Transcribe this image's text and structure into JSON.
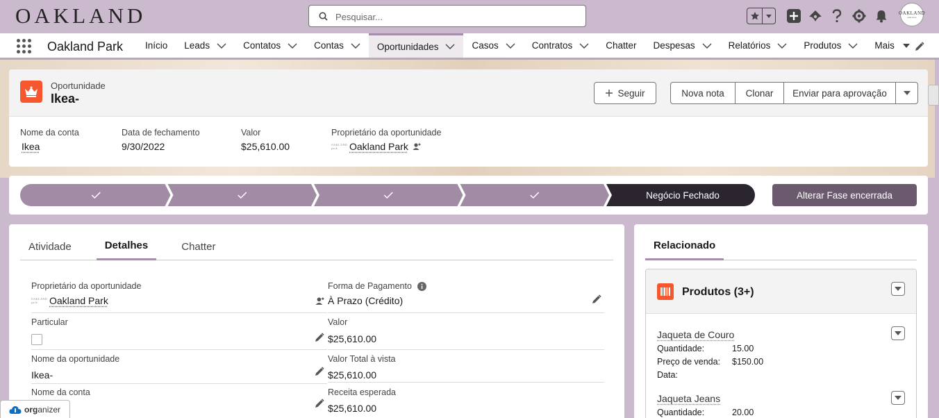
{
  "header": {
    "logo": "OAKLAND",
    "search_placeholder": "Pesquisar...",
    "avatar_text": "OAKLAND",
    "avatar_sub": "park store"
  },
  "nav": {
    "app_name": "Oakland Park",
    "items": [
      {
        "label": "Início",
        "chevron": false
      },
      {
        "label": "Leads",
        "chevron": true
      },
      {
        "label": "Contatos",
        "chevron": true
      },
      {
        "label": "Contas",
        "chevron": true
      },
      {
        "label": "Oportunidades",
        "chevron": true,
        "active": true
      },
      {
        "label": "Casos",
        "chevron": true
      },
      {
        "label": "Contratos",
        "chevron": true
      },
      {
        "label": "Chatter",
        "chevron": false
      },
      {
        "label": "Despesas",
        "chevron": true
      },
      {
        "label": "Relatórios",
        "chevron": true
      },
      {
        "label": "Produtos",
        "chevron": true
      },
      {
        "label": "Mais",
        "chevron": true
      }
    ]
  },
  "record": {
    "object_type": "Oportunidade",
    "name": "Ikea-",
    "follow_label": "Seguir",
    "actions": [
      "Nova nota",
      "Clonar",
      "Enviar para aprovação"
    ],
    "highlights": [
      {
        "label": "Nome da conta",
        "value": "Ikea",
        "link": true
      },
      {
        "label": "Data de fechamento",
        "value": "9/30/2022",
        "link": false
      },
      {
        "label": "Valor",
        "value": "$25,610.00",
        "link": false
      },
      {
        "label": "Proprietário da oportunidade",
        "value": "Oakland Park",
        "link": true,
        "owner": true
      }
    ]
  },
  "path": {
    "completed_steps": 4,
    "current_stage": "Negócio Fechado",
    "button_label": "Alterar Fase encerrada"
  },
  "tabs": {
    "items": [
      "Atividade",
      "Detalhes",
      "Chatter"
    ],
    "active": "Detalhes"
  },
  "details": {
    "left": [
      {
        "label": "Proprietário da oportunidade",
        "value": "Oakland Park",
        "type": "owner"
      },
      {
        "label": "Particular",
        "value": "",
        "type": "checkbox"
      },
      {
        "label": "Nome da oportunidade",
        "value": "Ikea-",
        "type": "text"
      },
      {
        "label": "Nome da conta",
        "value": "",
        "type": "text"
      }
    ],
    "right": [
      {
        "label": "Forma de Pagamento",
        "value": "À Prazo (Crédito)",
        "type": "info"
      },
      {
        "label": "Valor",
        "value": "$25,610.00",
        "type": "text"
      },
      {
        "label": "Valor Total à vista",
        "value": "$25,610.00",
        "type": "text"
      },
      {
        "label": "Receita esperada",
        "value": "$25,610.00",
        "type": "text"
      }
    ]
  },
  "related": {
    "tab_label": "Relacionado",
    "products_title": "Produtos (3+)",
    "products": [
      {
        "name": "Jaqueta de Couro",
        "qty_label": "Quantidade:",
        "qty": "15.00",
        "price_label": "Preço de venda:",
        "price": "$150.00",
        "date_label": "Data:"
      },
      {
        "name": "Jaqueta Jeans",
        "qty_label": "Quantidade:",
        "qty": "20.00"
      }
    ]
  },
  "organizer": {
    "bold": "org",
    "rest": "anizer"
  },
  "colors": {
    "accent": "#a58ea8",
    "header_bg": "#cbb9cd",
    "opp_icon": "#f7572e",
    "path_done": "#a28ca5",
    "path_current": "#2b2530",
    "button": "#6b5a6e"
  }
}
